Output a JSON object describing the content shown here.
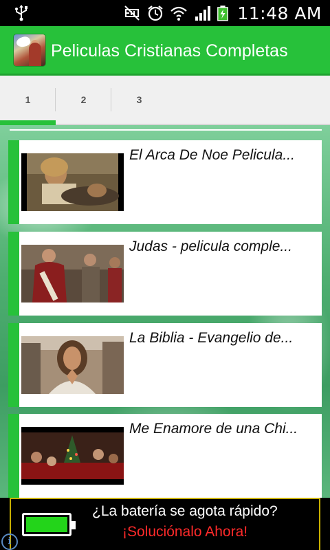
{
  "status_bar": {
    "time": "11:48 AM",
    "icons": [
      "usb-icon",
      "mute-icon",
      "alarm-icon",
      "wifi-icon",
      "signal-icon",
      "battery-charging-icon"
    ]
  },
  "action_bar": {
    "title": "Peliculas Cristianas Completas",
    "brand_color": "#27c13a"
  },
  "tabs": [
    {
      "label": "1",
      "active": true
    },
    {
      "label": "2",
      "active": false
    },
    {
      "label": "3",
      "active": false
    }
  ],
  "videos": [
    {
      "title": "El Arca De Noe Pelicula..."
    },
    {
      "title": "Judas - pelicula comple..."
    },
    {
      "title": "La Biblia - Evangelio de..."
    },
    {
      "title": "Me Enamore de una Chi..."
    }
  ],
  "ad": {
    "line1": "¿La batería se agota rápido?",
    "line2": "¡Soluciónalo Ahora!",
    "line2_color": "#ff2a2a"
  }
}
